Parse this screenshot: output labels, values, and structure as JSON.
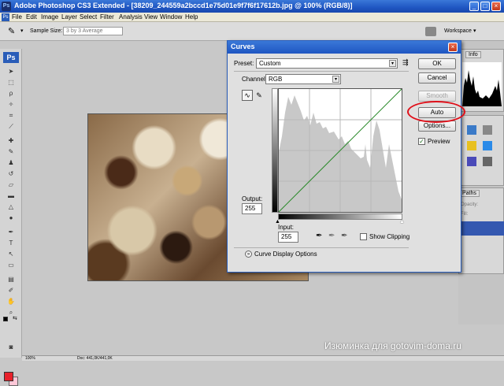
{
  "app": {
    "window_title": "Adobe Photoshop CS3 Extended - [38209_244559a2bccd1e75d01e9f7f6f17612b.jpg @ 100% (RGB/8)]",
    "logo": "Ps",
    "menu": [
      "File",
      "Edit",
      "Image",
      "Layer",
      "Select",
      "Filter",
      "Analysis",
      "View",
      "Window",
      "Help"
    ],
    "options_bar": {
      "sample_size_label": "Sample Size:",
      "sample_size_value": "3 by 3 Average",
      "workspace_label": "Workspace"
    },
    "status_bar": {
      "zoom": "100%",
      "doc_info": "Doc: 441,0K/441,0K"
    }
  },
  "dock": {
    "tabs_top": [
      "Info"
    ],
    "tabs_mid": [
      "Paths"
    ],
    "fields": [
      "Opacity:",
      "Fill:"
    ]
  },
  "curves_dialog": {
    "title": "Curves",
    "preset_label": "Preset:",
    "preset_value": "Custom",
    "channel_label": "Channel:",
    "channel_value": "RGB",
    "output_label": "Output:",
    "output_value": "255",
    "input_label": "Input:",
    "input_value": "255",
    "show_clipping_label": "Show Clipping",
    "show_clipping_checked": false,
    "display_options_label": "Curve Display Options",
    "buttons": {
      "ok": "OK",
      "cancel": "Cancel",
      "smooth": "Smooth",
      "auto": "Auto",
      "options": "Options..."
    },
    "preview_label": "Preview",
    "preview_checked": true,
    "histogram_color": "#c8c8c8",
    "curve_color": "#2a8a2a"
  },
  "colors": {
    "foreground": "#e8202a",
    "highlight": "#e0101a"
  },
  "watermark": "Изюминка для gotovim-doma.ru"
}
